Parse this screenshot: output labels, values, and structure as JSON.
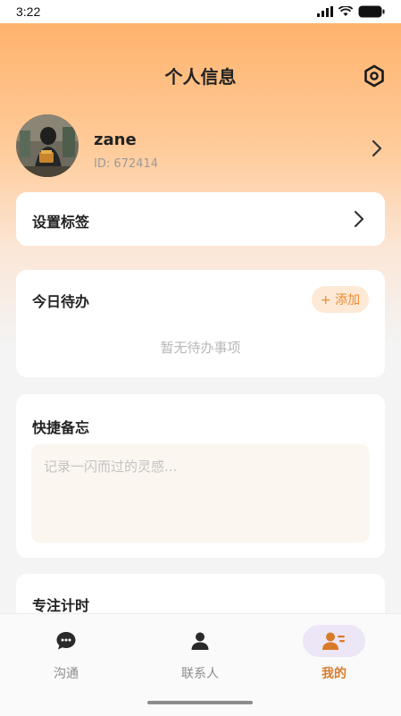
{
  "status_bar": {
    "time": "3:22"
  },
  "header": {
    "title": "个人信息",
    "settings_icon": "gear-hexagon-icon"
  },
  "profile": {
    "name": "zane",
    "id_text": "ID: 672414"
  },
  "tags_card": {
    "label": "设置标签"
  },
  "todo_card": {
    "title": "今日待办",
    "add_label": "+ 添加",
    "empty_text": "暂无待办事项"
  },
  "memo_card": {
    "title": "快捷备忘",
    "placeholder": "记录一闪而过的灵感...",
    "value": ""
  },
  "focus_card": {
    "title": "专注计时"
  },
  "bottom_nav": {
    "items": [
      {
        "label": "沟通",
        "icon": "chat-bubble-icon",
        "active": false
      },
      {
        "label": "联系人",
        "icon": "person-icon",
        "active": false
      },
      {
        "label": "我的",
        "icon": "profile-card-icon",
        "active": true
      }
    ]
  },
  "colors": {
    "accent": "#ea8a2e",
    "header_gradient_top": "#ffb36d",
    "nav_active_bg": "#ece6f7",
    "nav_active_text": "#d87b28"
  }
}
